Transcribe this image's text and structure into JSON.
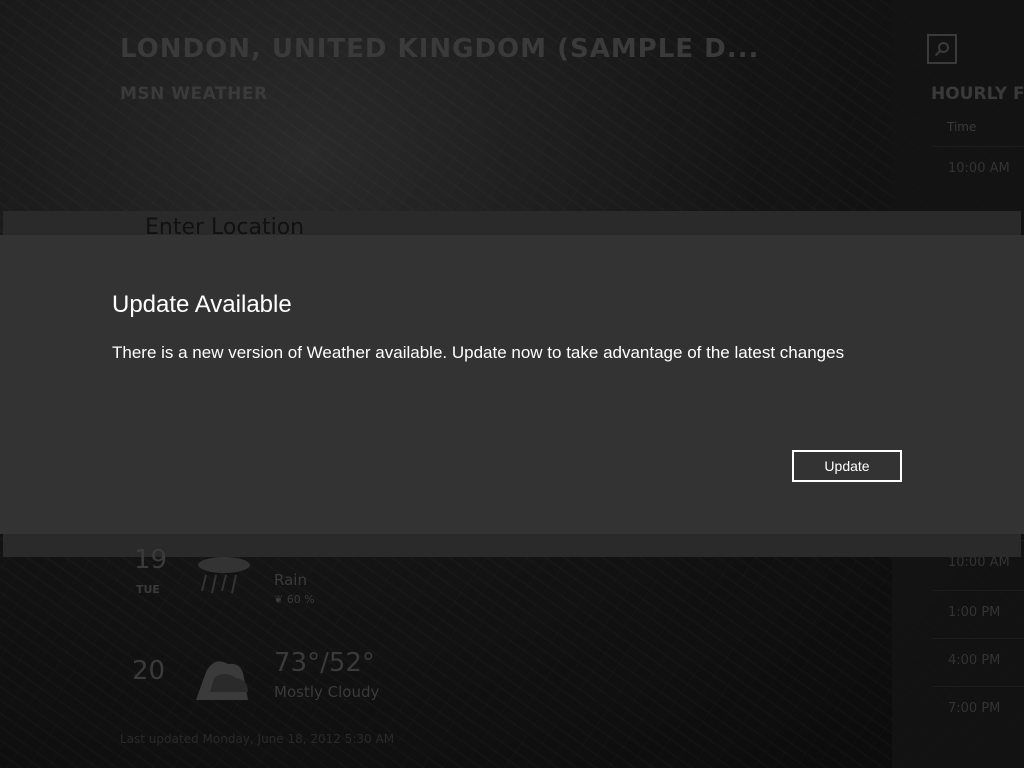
{
  "background": {
    "city_title": "LONDON, UNITED KINGDOM (SAMPLE D...",
    "app_name": "MSN WEATHER",
    "search_icon": "search-icon",
    "hourly_title": "HOURLY FO",
    "time_header": "Time",
    "hourly_rows": [
      "10:00 AM",
      "10:00 AM",
      "1:00 PM",
      "4:00 PM",
      "7:00 PM"
    ],
    "enter_location_text": "Enter Location",
    "days": [
      {
        "num": "19",
        "dow": "TUE",
        "temp": "",
        "condition": "Rain",
        "precip": "❦ 60 %"
      },
      {
        "num": "20",
        "dow": "",
        "temp": "73°/52°",
        "condition": "Mostly Cloudy",
        "precip": ""
      }
    ],
    "last_updated": "Last updated Monday, June 18, 2012 5:30 AM"
  },
  "dialog": {
    "title": "Update Available",
    "message": "There is a new version of Weather available. Update now to take advantage of the latest changes",
    "update_button": "Update"
  },
  "colors": {
    "dialog_bg": "#333333",
    "dialog_text": "#ffffff",
    "dim_text": "#3a3a3a"
  }
}
